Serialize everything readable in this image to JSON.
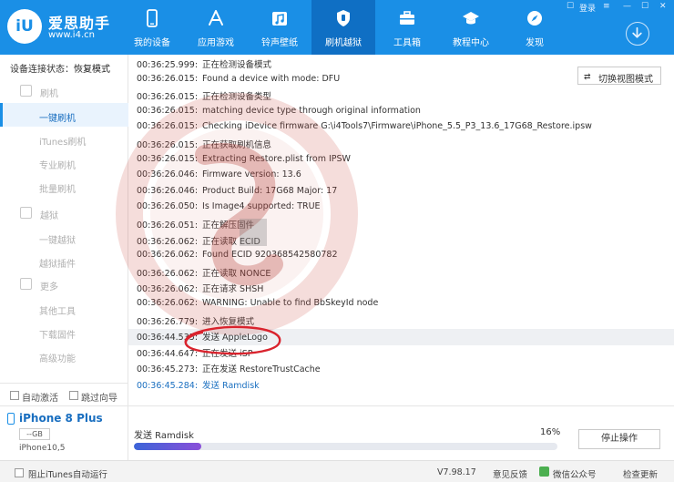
{
  "app": {
    "logo_text": "iU",
    "name": "爱思助手",
    "url": "www.i4.cn",
    "login": "登录",
    "brand_color": "#1a8fe6"
  },
  "nav": [
    {
      "label": "我的设备",
      "icon": "phone-icon",
      "active": false
    },
    {
      "label": "应用游戏",
      "icon": "app-store-icon",
      "active": false
    },
    {
      "label": "铃声壁纸",
      "icon": "music-icon",
      "active": false
    },
    {
      "label": "刷机越狱",
      "icon": "shield-icon",
      "active": true
    },
    {
      "label": "工具箱",
      "icon": "toolbox-icon",
      "active": false
    },
    {
      "label": "教程中心",
      "icon": "graduation-cap-icon",
      "active": false
    },
    {
      "label": "发现",
      "icon": "compass-icon",
      "active": false
    }
  ],
  "sidebar": {
    "status_label": "设备连接状态：",
    "status_value": "恢复模式",
    "groups": [
      {
        "label": "刷机",
        "items": [
          "一键刷机",
          "iTunes刷机",
          "专业刷机",
          "批量刷机"
        ]
      },
      {
        "label": "越狱",
        "items": [
          "一键越狱",
          "越狱插件"
        ]
      },
      {
        "label": "更多",
        "items": [
          "其他工具",
          "下载固件",
          "高级功能"
        ]
      }
    ],
    "active_item": "一键刷机",
    "auto_activate": "自动激活",
    "skip_guide": "跳过向导"
  },
  "device": {
    "name": "iPhone 8 Plus",
    "capacity": "--GB",
    "model": "iPhone10,5"
  },
  "main": {
    "switch_view": "切换视图模式",
    "log": [
      {
        "time": "00:36:25.999:",
        "text": "正在检测设备模式"
      },
      {
        "time": "00:36:26.015:",
        "text": "Found a device with mode: DFU"
      },
      {
        "time": "00:36:26.015:",
        "text": "正在检测设备类型"
      },
      {
        "time": "00:36:26.015:",
        "text": "matching device type through original information"
      },
      {
        "time": "00:36:26.015:",
        "text": "Checking iDevice firmware G:\\i4Tools7\\Firmware\\iPhone_5.5_P3_13.6_17G68_Restore.ipsw"
      },
      {
        "time": "00:36:26.015:",
        "text": "正在获取刷机信息"
      },
      {
        "time": "00:36:26.015:",
        "text": "Extracting Restore.plist from IPSW"
      },
      {
        "time": "00:36:26.046:",
        "text": "Firmware version: 13.6"
      },
      {
        "time": "00:36:26.046:",
        "text": "Product Build: 17G68 Major: 17"
      },
      {
        "time": "00:36:26.050:",
        "text": "Is Image4 supported: TRUE"
      },
      {
        "time": "00:36:26.051:",
        "text": "正在解压固件"
      },
      {
        "time": "00:36:26.062:",
        "text": "正在读取 ECID"
      },
      {
        "time": "00:36:26.062:",
        "text": "Found ECID 920368542580782"
      },
      {
        "time": "00:36:26.062:",
        "text": "正在读取 NONCE"
      },
      {
        "time": "00:36:26.062:",
        "text": "正在请求 SHSH"
      },
      {
        "time": "00:36:26.062:",
        "text": "WARNING: Unable to find BbSkeyId node"
      },
      {
        "time": "00:36:26.779:",
        "text": "进入恢复模式"
      },
      {
        "time": "00:36:44.535:",
        "text": "发送 AppleLogo"
      },
      {
        "time": "00:36:44.647:",
        "text": "正在发送 iSP"
      },
      {
        "time": "00:36:45.273:",
        "text": "正在发送 RestoreTrustCache"
      },
      {
        "time": "00:36:45.284:",
        "text": "发送 Ramdisk"
      }
    ],
    "highlight_index": 17,
    "active_index": 20,
    "active_color": "#1a6fc0",
    "annotation_color": "#d9232d"
  },
  "progress": {
    "label": "发送 Ramdisk",
    "percent_text": "16%",
    "fraction": 0.16,
    "stop_button": "停止操作"
  },
  "statusbar": {
    "block_itunes": "阻止iTunes自动运行",
    "version": "V7.98.17",
    "feedback": "意见反馈",
    "wechat": "微信公众号",
    "check_update": "检查更新"
  }
}
